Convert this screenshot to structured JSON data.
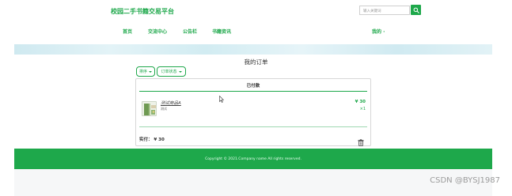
{
  "header": {
    "site_title": "校园二手书籍交易平台",
    "search_placeholder": "输入关键词"
  },
  "nav": {
    "items": [
      {
        "label": "首页"
      },
      {
        "label": "交流中心"
      },
      {
        "label": "公告栏"
      },
      {
        "label": "书籍资讯"
      }
    ],
    "user_label": "我的 ·"
  },
  "main": {
    "page_title": "我的订单",
    "filters": {
      "sort_label": "排序",
      "status_label": "订单状态"
    },
    "order": {
      "status_header": "已付款",
      "product_name": "测试商品A",
      "product_sub": "测试",
      "price": "¥ 30",
      "quantity": "×1",
      "total_label": "实付：  ¥ 30"
    }
  },
  "footer": {
    "copyright": "Copyright © 2021.Company name All rights reserved."
  },
  "watermark": "CSDN @BYSJ1987",
  "colors": {
    "accent": "#1ea84b"
  }
}
